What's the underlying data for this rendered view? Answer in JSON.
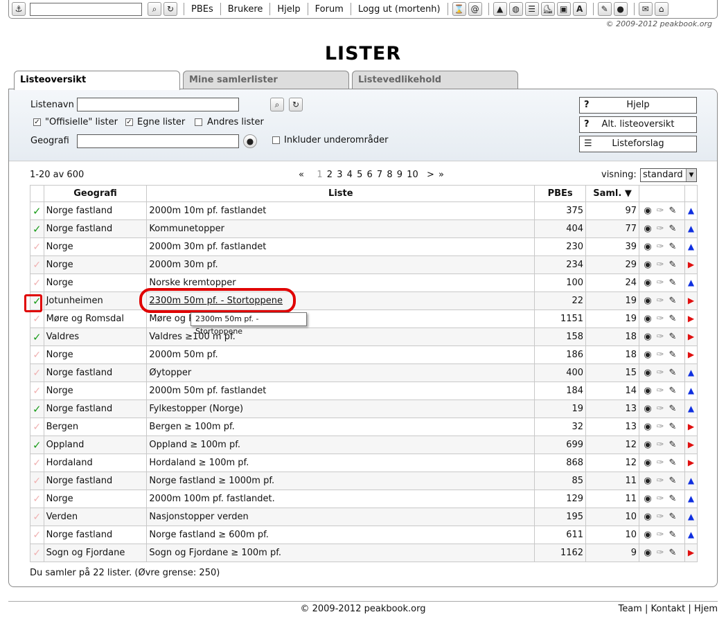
{
  "topbar": {
    "links": [
      "PBEs",
      "Brukere",
      "Hjelp",
      "Forum",
      "Logg ut (mortenh)"
    ],
    "search_value": ""
  },
  "copyright_top": "© 2009-2012 peakbook.org",
  "page_title": "LISTER",
  "tabs": [
    "Listeoversikt",
    "Mine samlerlister",
    "Listevedlikehold"
  ],
  "search": {
    "listname_label": "Listenavn",
    "listname_value": "",
    "official_label": "\"Offisielle\" lister",
    "own_label": "Egne lister",
    "others_label": "Andres lister",
    "geo_label": "Geografi",
    "geo_value": "",
    "include_sub_label": "Inkluder underområder",
    "help_button": "Hjelp",
    "alt_overview_button": "Alt. listeoversikt",
    "suggest_button": "Listeforslag"
  },
  "results": {
    "count_text": "1-20 av 600",
    "pager": [
      "«",
      "1",
      "2",
      "3",
      "4",
      "5",
      "6",
      "7",
      "8",
      "9",
      "10",
      ">",
      "»"
    ],
    "visning_label": "visning:",
    "visning_value": "standard",
    "columns": [
      "Geografi",
      "Liste",
      "PBEs",
      "Saml. ▼"
    ],
    "rows": [
      {
        "checked": true,
        "geo": "Norge fastland",
        "list": "2000m 10m pf. fastlandet",
        "pbes": "375",
        "saml": "97",
        "dir": "up"
      },
      {
        "checked": true,
        "geo": "Norge fastland",
        "list": "Kommunetopper",
        "pbes": "404",
        "saml": "77",
        "dir": "up"
      },
      {
        "checked": false,
        "geo": "Norge",
        "list": "2000m 30m pf. fastlandet",
        "pbes": "230",
        "saml": "39",
        "dir": "up"
      },
      {
        "checked": false,
        "geo": "Norge",
        "list": "2000m 30m pf.",
        "pbes": "234",
        "saml": "29",
        "dir": "right"
      },
      {
        "checked": false,
        "geo": "Norge",
        "list": "Norske kremtopper",
        "pbes": "100",
        "saml": "24",
        "dir": "up"
      },
      {
        "checked": true,
        "geo": "Jotunheimen",
        "list": "2300m 50m pf. - Stortoppene",
        "pbes": "22",
        "saml": "19",
        "dir": "right"
      },
      {
        "checked": false,
        "geo": "Møre og Romsdal",
        "list": "Møre og Romsdal",
        "pbes": "1151",
        "saml": "19",
        "dir": "right"
      },
      {
        "checked": true,
        "geo": "Valdres",
        "list": "Valdres ≥100 m pf.",
        "pbes": "158",
        "saml": "18",
        "dir": "right"
      },
      {
        "checked": false,
        "geo": "Norge",
        "list": "2000m 50m pf.",
        "pbes": "186",
        "saml": "18",
        "dir": "right"
      },
      {
        "checked": false,
        "geo": "Norge fastland",
        "list": "Øytopper",
        "pbes": "400",
        "saml": "15",
        "dir": "up"
      },
      {
        "checked": false,
        "geo": "Norge",
        "list": "2000m 50m pf. fastlandet",
        "pbes": "184",
        "saml": "14",
        "dir": "up"
      },
      {
        "checked": true,
        "geo": "Norge fastland",
        "list": "Fylkestopper (Norge)",
        "pbes": "19",
        "saml": "13",
        "dir": "up"
      },
      {
        "checked": false,
        "geo": "Bergen",
        "list": "Bergen ≥ 100m pf.",
        "pbes": "32",
        "saml": "13",
        "dir": "right"
      },
      {
        "checked": true,
        "geo": "Oppland",
        "list": "Oppland ≥ 100m pf.",
        "pbes": "699",
        "saml": "12",
        "dir": "right"
      },
      {
        "checked": false,
        "geo": "Hordaland",
        "list": "Hordaland ≥ 100m pf.",
        "pbes": "868",
        "saml": "12",
        "dir": "right"
      },
      {
        "checked": false,
        "geo": "Norge fastland",
        "list": "Norge fastland ≥ 1000m pf.",
        "pbes": "85",
        "saml": "11",
        "dir": "up"
      },
      {
        "checked": false,
        "geo": "Norge",
        "list": "2000m 100m pf. fastlandet.",
        "pbes": "129",
        "saml": "11",
        "dir": "up"
      },
      {
        "checked": false,
        "geo": "Verden",
        "list": "Nasjonstopper verden",
        "pbes": "195",
        "saml": "10",
        "dir": "up"
      },
      {
        "checked": false,
        "geo": "Norge fastland",
        "list": "Norge fastland ≥ 600m pf.",
        "pbes": "611",
        "saml": "10",
        "dir": "up"
      },
      {
        "checked": false,
        "geo": "Sogn og Fjordane",
        "list": "Sogn og Fjordane ≥ 100m pf.",
        "pbes": "1162",
        "saml": "9",
        "dir": "right"
      }
    ],
    "tooltip": "2300m 50m pf. - Stortoppene",
    "footnote": "Du samler på 22 lister. (Øvre grense: 250)"
  },
  "footer": {
    "copyright": "© 2009-2012 peakbook.org",
    "links": [
      "Team",
      "Kontakt",
      "Hjem"
    ]
  },
  "colors": {
    "check_green": "#1a9c1a",
    "arrow_up": "#1030e0",
    "arrow_right": "#e01010",
    "annotation_red": "#e00000"
  }
}
